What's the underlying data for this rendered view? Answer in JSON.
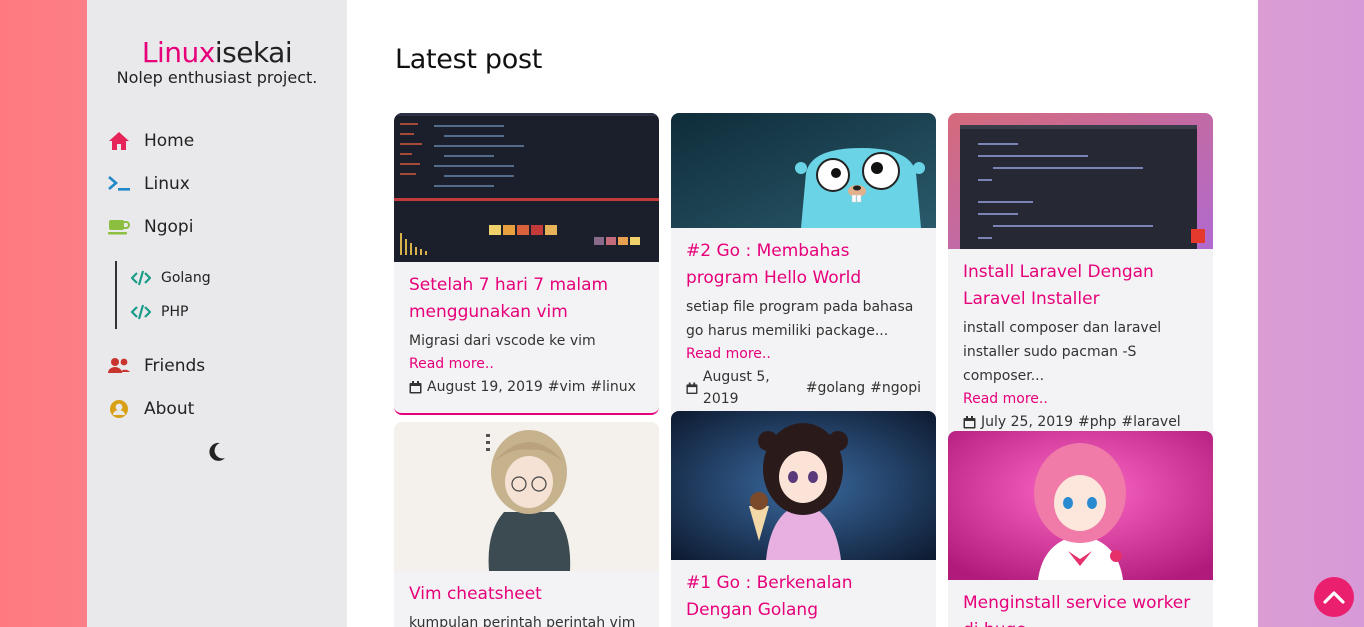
{
  "sidebar": {
    "brand_accent": "Linux",
    "brand_rest": "isekai",
    "tagline": "Nolep enthusiast project.",
    "nav": [
      {
        "label": "Home",
        "icon": "home-icon"
      },
      {
        "label": "Linux",
        "icon": "terminal-icon"
      },
      {
        "label": "Ngopi",
        "icon": "coffee-icon"
      },
      {
        "label": "Friends",
        "icon": "users-icon"
      },
      {
        "label": "About",
        "icon": "user-circle-icon"
      }
    ],
    "sub_nav": [
      {
        "label": "Golang",
        "icon": "code-icon"
      },
      {
        "label": "PHP",
        "icon": "code-icon"
      }
    ],
    "theme_toggle_icon": "moon-icon"
  },
  "main": {
    "title": "Latest post",
    "read_more": "Read more..",
    "posts": [
      {
        "title": "Setelah 7 hari 7 malam menggunakan vim",
        "excerpt": "Migrasi dari vscode ke vim",
        "date": "August 19, 2019",
        "tags": [
          "#vim",
          "#linux"
        ]
      },
      {
        "title": "#2 Go : Membahas program Hello World",
        "excerpt": "setiap file program pada bahasa go harus memiliki package...",
        "date": "August 5, 2019",
        "tags": [
          "#golang",
          "#ngopi"
        ]
      },
      {
        "title": "Install Laravel Dengan Laravel Installer",
        "excerpt": "install composer dan laravel installer sudo pacman -S composer...",
        "date": "July 25, 2019",
        "tags": [
          "#php",
          "#laravel"
        ]
      },
      {
        "title": "Vim cheatsheet",
        "excerpt": "kumpulan perintah perintah vim"
      },
      {
        "title": "#1 Go : Berkenalan Dengan Golang"
      },
      {
        "title": "Menginstall service worker di hugo"
      }
    ]
  },
  "colors": {
    "accent": "#e6007a",
    "scroll_top": "#ea1f6e",
    "sidebar_bg": "#e9e9ec"
  },
  "scroll_top_icon": "chevron-up-icon"
}
